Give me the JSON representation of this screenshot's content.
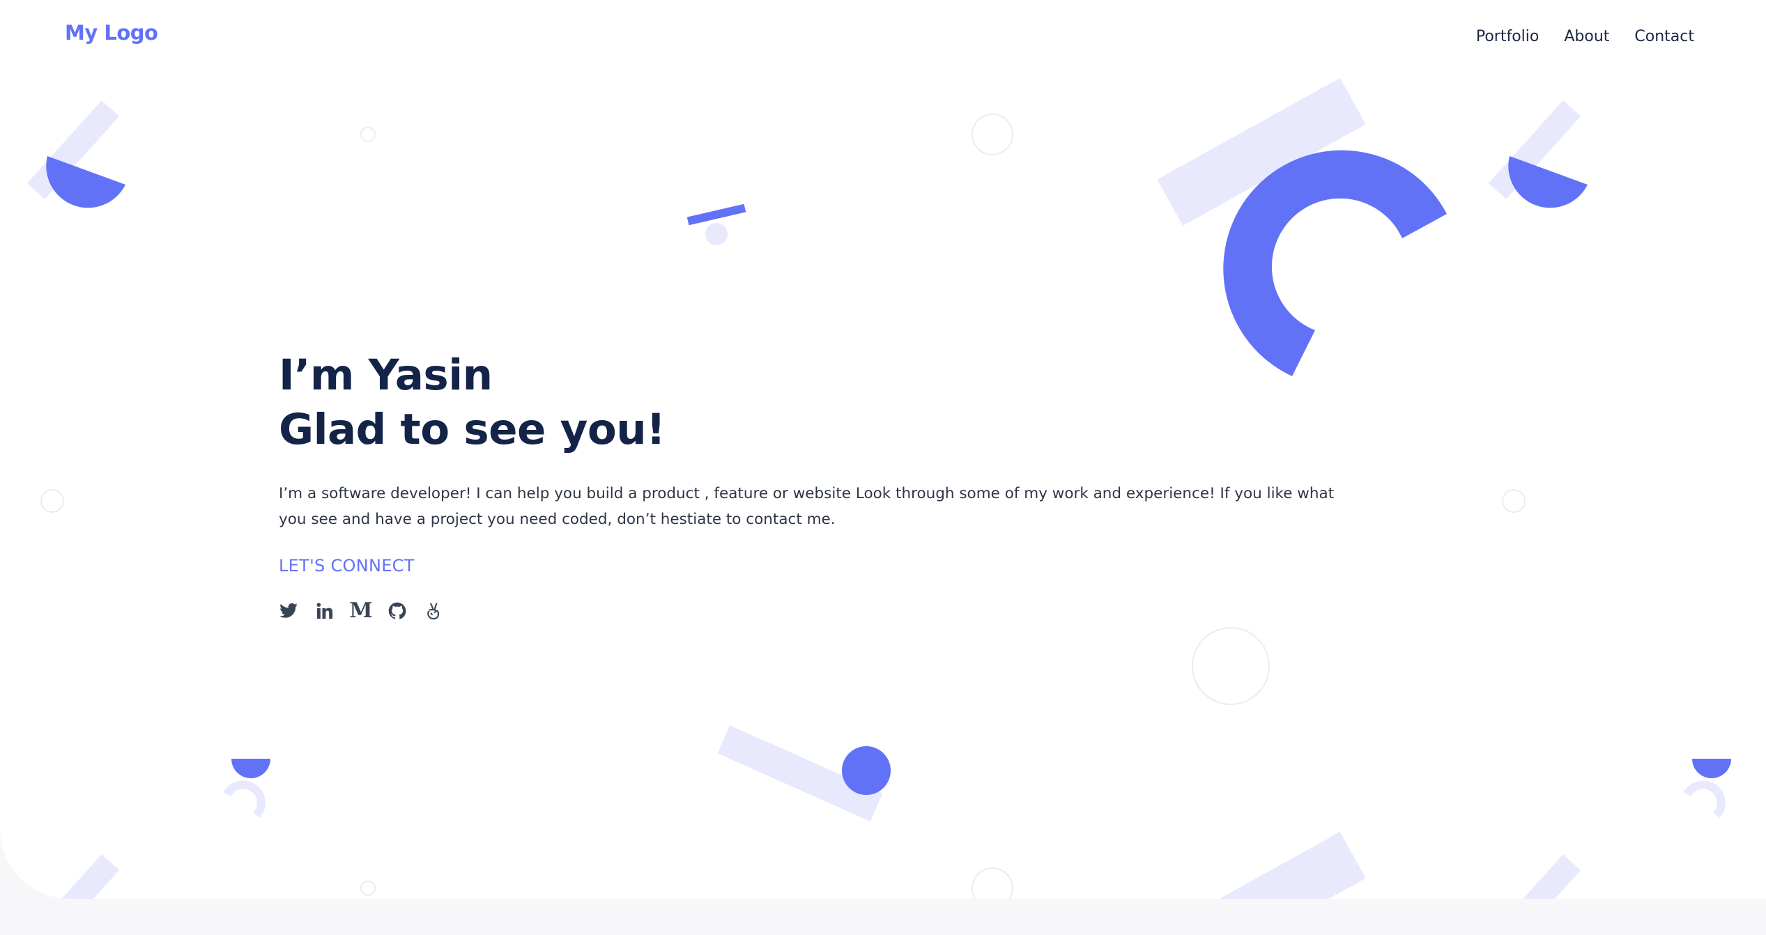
{
  "header": {
    "logo": "My Logo",
    "nav": [
      {
        "label": "Portfolio"
      },
      {
        "label": "About"
      },
      {
        "label": "Contact"
      }
    ]
  },
  "hero": {
    "title_line_1": "I’m Yasin",
    "title_line_2": "Glad to see you!",
    "bio": "I’m a software developer! I can help you build a product , feature or website Look through some of my work and experience! If you like what you see and have a project you need coded, don’t hestiate to contact me.",
    "connect_label": "LET'S CONNECT",
    "socials": [
      {
        "icon": "twitter-icon"
      },
      {
        "icon": "linkedin-icon"
      },
      {
        "icon": "medium-icon",
        "glyph": "M"
      },
      {
        "icon": "github-icon"
      },
      {
        "icon": "angellist-icon"
      }
    ]
  },
  "colors": {
    "accent": "#6272f7",
    "accent_light": "#e8e9fd",
    "heading": "#142448",
    "text": "#2e3646",
    "footer_bg": "#f7f7f9"
  }
}
